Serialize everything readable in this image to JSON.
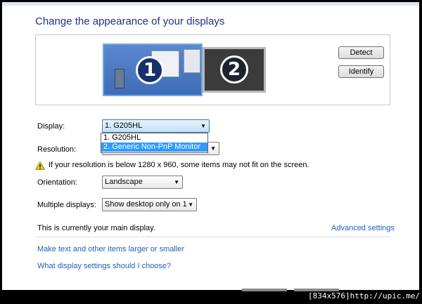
{
  "title": "Change the appearance of your displays",
  "preview": {
    "monitor1_number": "1",
    "monitor2_number": "2",
    "detect_label": "Detect",
    "identify_label": "Identify"
  },
  "display": {
    "label": "Display:",
    "selected": "1. G205HL",
    "options": [
      "1. G205HL",
      "2. Generic Non-PnP Monitor"
    ]
  },
  "resolution": {
    "label": "Resolution:"
  },
  "warning": "If your resolution is below 1280 x 960, some items may not fit on the screen.",
  "orientation": {
    "label": "Orientation:",
    "selected": "Landscape"
  },
  "multiple_displays": {
    "label": "Multiple displays:",
    "selected": "Show desktop only on 1"
  },
  "main_display_text": "This is currently your main display.",
  "advanced_settings": "Advanced settings",
  "links": {
    "larger_smaller": "Make text and other items larger or smaller",
    "which_settings": "What display settings should I choose?"
  },
  "watermark": "[834x576]http://upic.me/",
  "colors": {
    "title": "#1e3287",
    "link": "#1f5fb5",
    "highlight": "#3399ff"
  }
}
